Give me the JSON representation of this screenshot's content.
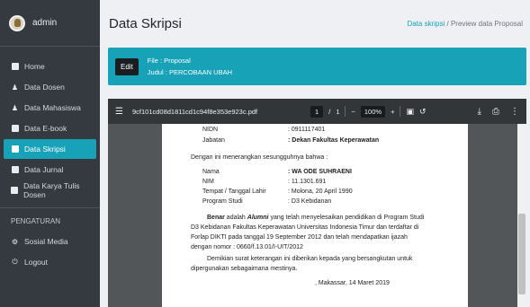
{
  "sidebar": {
    "user": "admin",
    "items": [
      {
        "label": "Home",
        "icon": "home-icon"
      },
      {
        "label": "Data Dosen",
        "icon": "user-icon"
      },
      {
        "label": "Data Mahasiswa",
        "icon": "users-icon"
      },
      {
        "label": "Data E-book",
        "icon": "book-icon"
      },
      {
        "label": "Data Skripsi",
        "icon": "book-icon"
      },
      {
        "label": "Data Jurnal",
        "icon": "book-icon"
      },
      {
        "label": "Data Karya Tulis Dosen",
        "icon": "book-icon"
      }
    ],
    "section_label": "PENGATURAN",
    "settings": [
      {
        "label": "Sosial Media",
        "icon": "gear-icon"
      },
      {
        "label": "Logout",
        "icon": "power-icon"
      }
    ]
  },
  "header": {
    "title": "Data Skripsi",
    "breadcrumb_link": "Data skripsi",
    "breadcrumb_sep": "/",
    "breadcrumb_current": "Preview data Proposal"
  },
  "banner": {
    "edit_label": "Edit",
    "file_line": "File : Proposal",
    "judul_line": "Judul : PERCOBAAN UBAH"
  },
  "viewer": {
    "filename": "9cf101cd08d1811cd1c94f8e353e923c.pdf",
    "page_current": "1",
    "page_sep": "/",
    "page_total": "1",
    "zoom_minus": "−",
    "zoom": "100%",
    "zoom_plus": "+"
  },
  "pdf": {
    "nidn_label": "NIDN",
    "nidn_value": ": 0911117401",
    "jabatan_label": "Jabatan",
    "jabatan_value": ": Dekan Fakultas Keperawatan",
    "intro": "Dengan ini menerangkan sesungguhnya bahwa :",
    "nama_label": "Nama",
    "nama_value": ": WA ODE SUHRAENI",
    "nim_label": "NIM",
    "nim_value": ": 11.1301.691",
    "ttl_label": "Tempat / Tanggal Lahir",
    "ttl_value": ": Molona, 20 April 1990",
    "prodi_label": "Program Studi",
    "prodi_value": ": D3 Kebidanan",
    "p1_line1_a": "Benar",
    "p1_line1_b": "adalah",
    "p1_line1_c": "Alumni",
    "p1_line1_d": "yang telah menyelesaikan pendidikan di Program Studi",
    "p1_line2": "D3 Kebidanan Fakultas Keperawatan Universitas Indonesia Timur dan terdaftar di",
    "p1_line3": "Forlap DIKTI pada tanggal 19 September 2012 dan telah mendapatkan ijazah",
    "p1_line4": "dengan nomor : 0660/f.13.01/I-UIT/2012",
    "p2_line1": "Demikian surat keterangan ini diberikan kepada yang bersangkutan untuk",
    "p2_line2": "dipergunakan sebagaimana mestinya.",
    "place_date": ", Makassar, 14 Maret 2019"
  }
}
